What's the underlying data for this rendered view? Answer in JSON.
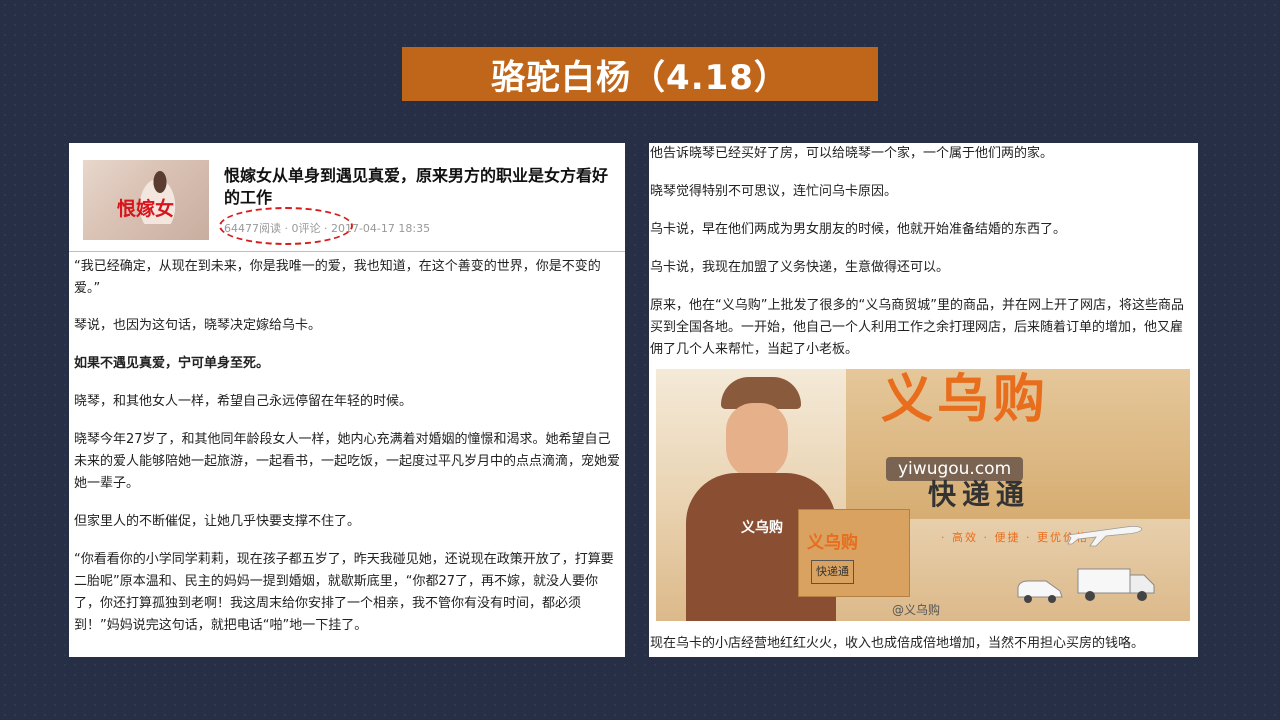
{
  "title": "骆驼白杨（4.18）",
  "left_panel": {
    "thumbnail_text": "恨嫁女",
    "headline": "恨嫁女从单身到遇见真爱，原来男方的职业是女方看好的工作",
    "meta": "64477阅读 · 0评论 · 2017-04-17 18:35",
    "paragraphs": [
      "“我已经确定，从现在到未来，你是我唯一的爱，我也知道，在这个善变的世界，你是不变的爱。”",
      "琴说，也因为这句话，晓琴决定嫁给乌卡。",
      "如果不遇见真爱，宁可单身至死。",
      "晓琴，和其他女人一样，希望自己永远停留在年轻的时候。",
      "晓琴今年27岁了，和其他同年龄段女人一样，她内心充满着对婚姻的憧憬和渴求。她希望自己未来的爱人能够陪她一起旅游，一起看书，一起吃饭，一起度过平凡岁月中的点点滴滴，宠她爱她一辈子。",
      "但家里人的不断催促，让她几乎快要支撑不住了。",
      "“你看看你的小学同学莉莉，现在孩子都五岁了，昨天我碰见她，还说现在政策开放了，打算要二胎呢”原本温和、民主的妈妈一提到婚姻，就歇斯底里，“你都27了，再不嫁，就没人要你了，你还打算孤独到老啊！我这周末给你安排了一个相亲，我不管你有没有时间，都必须到！”妈妈说完这句话，就把电话“啪”地一下挂了。"
    ]
  },
  "right_panel": {
    "paragraphs": [
      "他告诉晓琴已经买好了房，可以给晓琴一个家，一个属于他们两的家。",
      "晓琴觉得特别不可思议，连忙问乌卡原因。",
      "乌卡说，早在他们两成为男女朋友的时候，他就开始准备结婚的东西了。",
      "乌卡说，我现在加盟了义务快递，生意做得还可以。",
      "原来，他在“义乌购”上批发了很多的“义乌商贸城”里的商品，并在网上开了网店，将这些商品买到全国各地。一开始，他自己一个人利用工作之余打理网店，后来随着订单的增加，他又雇佣了几个人来帮忙，当起了小老板。"
    ],
    "promo": {
      "brand": "义乌购",
      "url": "yiwugou.com",
      "slogan": "快递通",
      "features": "· 高效 · 便捷 · 更优价格",
      "shirt_text": "义乌购",
      "parcel_text": "义乌购",
      "parcel_sub": "快递通",
      "weibo": "@义乌购"
    },
    "last_line": "现在乌卡的小店经营地红红火火，收入也成倍成倍地增加，当然不用担心买房的钱咯。"
  }
}
